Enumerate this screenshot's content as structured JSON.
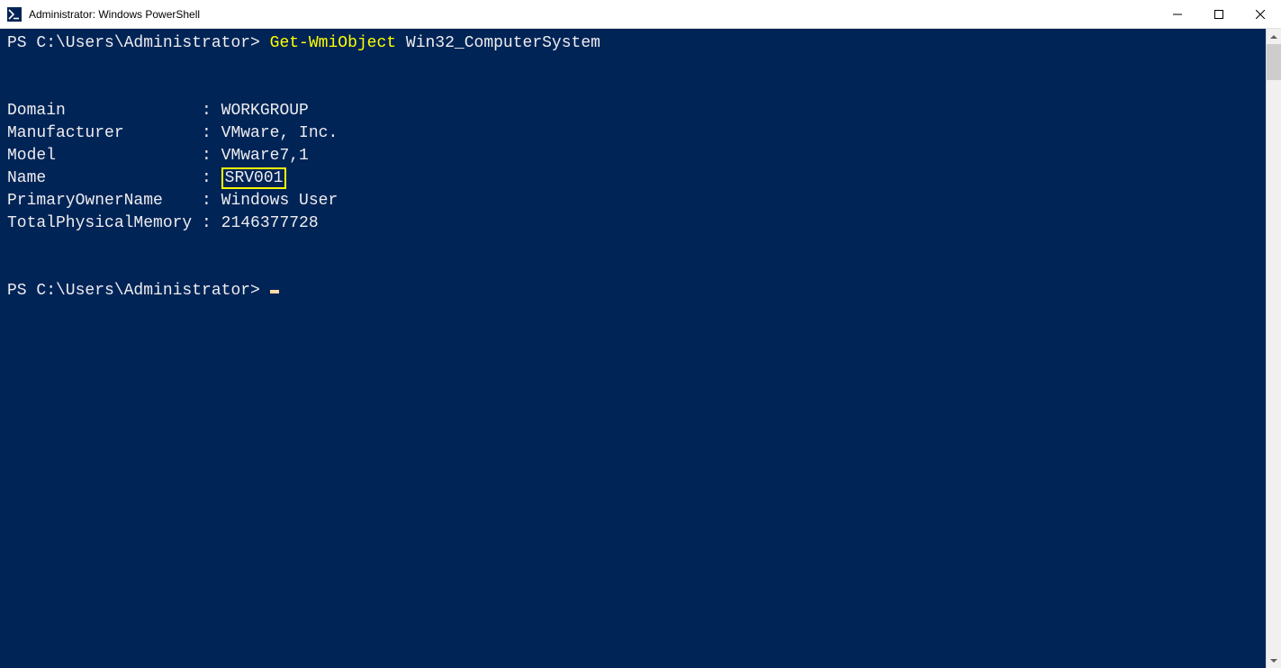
{
  "window": {
    "title": "Administrator: Windows PowerShell"
  },
  "terminal": {
    "prompt1": "PS C:\\Users\\Administrator> ",
    "cmdlet": "Get-WmiObject",
    "argspace": " ",
    "argument": "Win32_ComputerSystem",
    "output": {
      "fields": [
        {
          "key": "Domain             ",
          "sep": " : ",
          "value": "WORKGROUP"
        },
        {
          "key": "Manufacturer       ",
          "sep": " : ",
          "value": "VMware, Inc."
        },
        {
          "key": "Model              ",
          "sep": " : ",
          "value": "VMware7,1"
        },
        {
          "key": "Name               ",
          "sep": " : ",
          "value": "SRV001",
          "highlight": true
        },
        {
          "key": "PrimaryOwnerName   ",
          "sep": " : ",
          "value": "Windows User"
        },
        {
          "key": "TotalPhysicalMemory",
          "sep": " : ",
          "value": "2146377728"
        }
      ]
    },
    "prompt2": "PS C:\\Users\\Administrator> "
  }
}
